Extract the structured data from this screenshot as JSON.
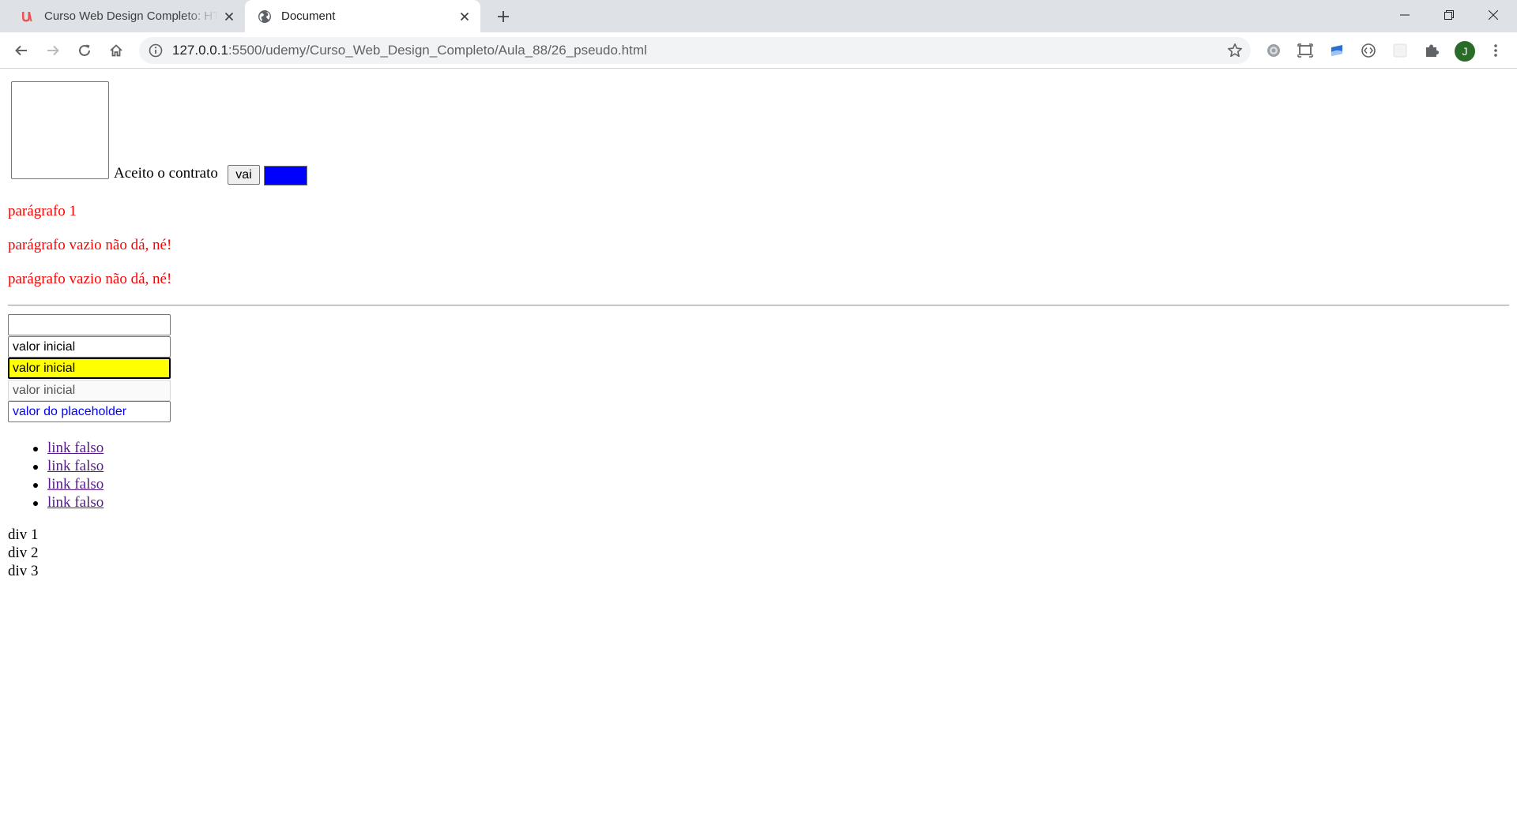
{
  "browser": {
    "tabs": [
      {
        "title": "Curso Web Design Completo: HTML",
        "favicon": "udemy-logo-icon",
        "active": false
      },
      {
        "title": "Document",
        "favicon": "globe-icon",
        "active": true
      }
    ],
    "new_tab_icon": "plus-icon",
    "window_controls": [
      "minimize-icon",
      "restore-icon",
      "close-icon"
    ],
    "nav": [
      "back-arrow-icon",
      "forward-arrow-icon",
      "reload-icon",
      "home-icon"
    ],
    "url_host": "127.0.0.1",
    "url_rest": ":5500/udemy/Curso_Web_Design_Completo/Aula_88/26_pseudo.html",
    "avatar_initial": "J",
    "extensions": [
      "gear-extension-icon",
      "screen-capture-icon",
      "cloud-extension-icon",
      "code-extension-icon",
      "blank-extension-icon",
      "puzzle-icon"
    ],
    "accent": "#1a73e8"
  },
  "page": {
    "checkbox_label": "Aceito o contrato",
    "button_label": "vai",
    "blue_button_color": "#0000ff",
    "paragraphs": [
      "parágrafo 1",
      "parágrafo vazio não dá, né!",
      "parágrafo vazio não dá, né!"
    ],
    "paragraph_color": "#ff0000",
    "inputs": [
      {
        "value": "",
        "style": "empty"
      },
      {
        "value": "valor inicial",
        "style": "default"
      },
      {
        "value": "valor inicial",
        "style": "highlighted",
        "background": "#ffff00"
      },
      {
        "value": "valor inicial",
        "style": "readonly"
      },
      {
        "placeholder": "valor do placeholder",
        "style": "placeholder",
        "color": "#0000ff"
      }
    ],
    "links": [
      "link falso",
      "link falso",
      "link falso",
      "link falso"
    ],
    "divs": [
      "div 1",
      "div 2",
      "div 3"
    ]
  }
}
